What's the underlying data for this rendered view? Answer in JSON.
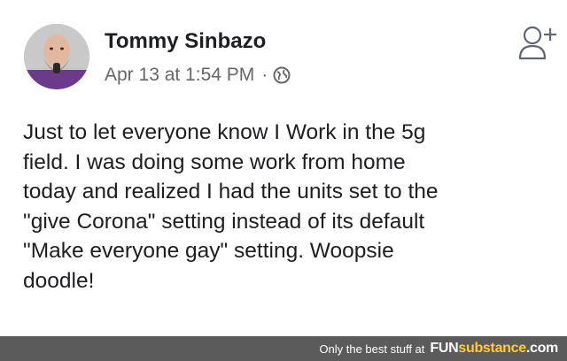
{
  "post": {
    "author": "Tommy Sinbazo",
    "timestamp": "Apr 13 at 1:54 PM",
    "separator": "·",
    "privacy_icon": "globe-icon",
    "action_icon": "add-friend-icon",
    "text": "Just to let everyone know I Work in the 5g\nfield. I was doing some work from home\ntoday and realized I had the units set to the\n\"give Corona\" setting instead of its default\n\"Make everyone gay\" setting. Woopsie\ndoodle!"
  },
  "watermark": {
    "caption": "Only the best stuff at",
    "brand_fun": "FUN",
    "brand_sub": "substance",
    "brand_suffix": ".com"
  },
  "colors": {
    "text": "#1c1e21",
    "meta": "#65676b",
    "footer_bg": "#5b5b5b"
  }
}
